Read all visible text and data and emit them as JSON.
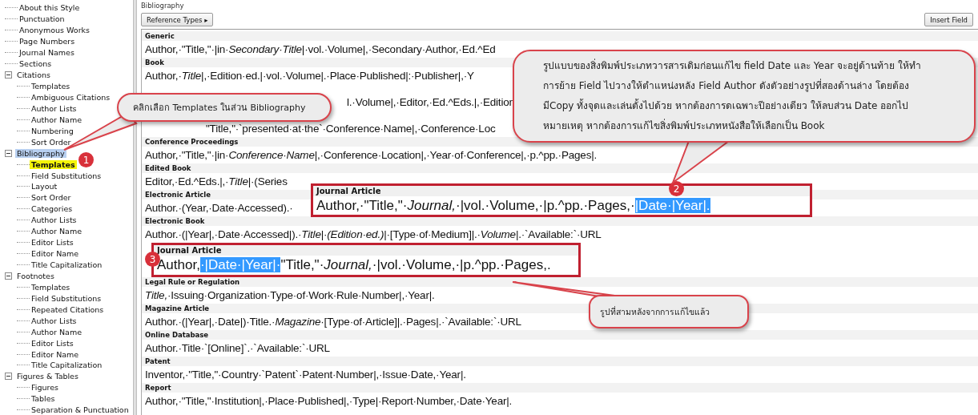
{
  "tree": [
    {
      "label": "About this Style",
      "selected": false,
      "highlighted": false
    },
    {
      "label": "Punctuation",
      "selected": false,
      "highlighted": false
    },
    {
      "label": "Anonymous Works",
      "selected": false,
      "highlighted": false
    },
    {
      "label": "Page Numbers",
      "selected": false,
      "highlighted": false
    },
    {
      "label": "Journal Names",
      "selected": false,
      "highlighted": false
    },
    {
      "label": "Sections",
      "selected": false,
      "highlighted": false
    },
    {
      "label": "Citations",
      "selected": false,
      "highlighted": false,
      "expanded": true,
      "children": [
        {
          "label": "Templates",
          "selected": false,
          "highlighted": false
        },
        {
          "label": "Ambiguous Citations",
          "selected": false,
          "highlighted": false
        },
        {
          "label": "Author Lists",
          "selected": false,
          "highlighted": false
        },
        {
          "label": "Author Name",
          "selected": false,
          "highlighted": false
        },
        {
          "label": "Numbering",
          "selected": false,
          "highlighted": false
        },
        {
          "label": "Sort Order",
          "selected": false,
          "highlighted": false
        }
      ]
    },
    {
      "label": "Bibliography",
      "selected": true,
      "highlighted": false,
      "expanded": true,
      "children": [
        {
          "label": "Templates",
          "selected": false,
          "highlighted": true
        },
        {
          "label": "Field Substitutions",
          "selected": false,
          "highlighted": false
        },
        {
          "label": "Layout",
          "selected": false,
          "highlighted": false
        },
        {
          "label": "Sort Order",
          "selected": false,
          "highlighted": false
        },
        {
          "label": "Categories",
          "selected": false,
          "highlighted": false
        },
        {
          "label": "Author Lists",
          "selected": false,
          "highlighted": false
        },
        {
          "label": "Author Name",
          "selected": false,
          "highlighted": false
        },
        {
          "label": "Editor Lists",
          "selected": false,
          "highlighted": false
        },
        {
          "label": "Editor Name",
          "selected": false,
          "highlighted": false
        },
        {
          "label": "Title Capitalization",
          "selected": false,
          "highlighted": false
        }
      ]
    },
    {
      "label": "Footnotes",
      "selected": false,
      "highlighted": false,
      "expanded": true,
      "children": [
        {
          "label": "Templates",
          "selected": false,
          "highlighted": false
        },
        {
          "label": "Field Substitutions",
          "selected": false,
          "highlighted": false
        },
        {
          "label": "Repeated Citations",
          "selected": false,
          "highlighted": false
        },
        {
          "label": "Author Lists",
          "selected": false,
          "highlighted": false
        },
        {
          "label": "Author Name",
          "selected": false,
          "highlighted": false
        },
        {
          "label": "Editor Lists",
          "selected": false,
          "highlighted": false
        },
        {
          "label": "Editor Name",
          "selected": false,
          "highlighted": false
        },
        {
          "label": "Title Capitalization",
          "selected": false,
          "highlighted": false
        }
      ]
    },
    {
      "label": "Figures & Tables",
      "selected": false,
      "highlighted": false,
      "expanded": true,
      "children": [
        {
          "label": "Figures",
          "selected": false,
          "highlighted": false
        },
        {
          "label": "Tables",
          "selected": false,
          "highlighted": false
        },
        {
          "label": "Separation & Punctuation",
          "selected": false,
          "highlighted": false
        }
      ]
    }
  ],
  "panel": {
    "title": "Bibliography",
    "reference_types_button": "Reference Types ▸",
    "insert_field_button": "Insert Field"
  },
  "templates": [
    {
      "kind": "row",
      "label": "Generic",
      "template": "Author,·\"Title,\"·|in·*Secondary·Title*|·vol.·Volume|,·Secondary·Author,·Ed.^Ed"
    },
    {
      "kind": "row",
      "label": "Book",
      "template": "Author,·*Title*|,·Edition·ed.|·vol.·Volume|.·Place·Published|:·Publisher|,·Y"
    },
    {
      "kind": "under_callout",
      "template": "l.·Volume|,·Editor,·Ed.^Eds.|,·Edition"
    },
    {
      "kind": "under_pointer",
      "template": "\"Title,\"·`presented·at·the`·Conference·Name|,·Conference·Loc"
    },
    {
      "kind": "row",
      "label": "Conference Proceedings",
      "template": "Author,·\"Title,\"·|in·*Conference·Name*|,·Conference·Location|,·Year·of·Conference|,·p.^pp.·Pages|."
    },
    {
      "kind": "row",
      "label": "Edited Book",
      "template": "Editor,·Ed.^Eds.|,·*Title*|·(Series"
    },
    {
      "kind": "row",
      "label": "Electronic Article",
      "template": "Author.·(Year,·Date·Accessed).·"
    },
    {
      "kind": "row",
      "label": "Electronic Book",
      "template": "Author.·(|Year|,·Date·Accessed|).·*Title*|·*(Edition·ed.)*|·[Type·of·Medium]|.·*Volume*|.·`Available:`·URL"
    },
    {
      "kind": "inset",
      "badge": "3",
      "label": "Journal Article",
      "template": "Author,",
      "selection": "·|Date·|Year|·",
      "rest": "\"Title,\"·*Journal,*·|vol.·Volume,·|p.^pp.·Pages,."
    },
    {
      "kind": "row",
      "label": "Legal Rule or Regulation",
      "template": "*Title,*·Issuing·Organization·Type·of·Work·Rule·Number|,·Year|."
    },
    {
      "kind": "row",
      "label": "Magazine Article",
      "template": "Author.·(|Year|,·Date|)·Title.·*Magazine*·[Type·of·Article]|.·Pages|.·`Available:`·URL"
    },
    {
      "kind": "row",
      "label": "Online Database",
      "template": "Author.·Title·`[Online]`.·`Available:`·URL"
    },
    {
      "kind": "row",
      "label": "Patent",
      "template": "Inventor,·\"Title,\"·Country·`Patent`·Patent·Number|,·Issue·Date,·Year|."
    },
    {
      "kind": "row",
      "label": "Report",
      "template": "Author,·\"Title,\"·Institution|,·Place·Published|,·Type|·Report·Number,·Date·Year|."
    }
  ],
  "original_box": {
    "badge": "2",
    "label": "Journal Article",
    "template": "Author,·\"Title,\"·*Journal,*·|vol.·Volume,·|p.^pp.·Pages,·",
    "selection": "|Date·|Year|."
  },
  "callouts": [
    {
      "kind": "left",
      "badge": "1",
      "text": "คลิกเลือก Templates ในส่วน Bibliography"
    },
    {
      "kind": "big",
      "lines": [
        "รูปแบบของสิ่งพิมพ์ประเภทวารสารเดิมก่อนแก้ไข field Date และ  Year จะอยู่ด้านท้าย ให้ทำ",
        "การย้าย Field ไปวางให้ตำแหน่งหลัง Field Author ดังตัวอย่างรูปที่สองด้านล่าง โดยต้อง",
        "มีCopy ทั้งจุดและเล่นตั้งไปด้วย หากต้องการดเฉพาะปีอย่างเดียว ให้ลบส่วน Date ออกไป",
        "หมายเหตุ หากต้องการแก้ไขสิ่งพิมพ์ประเภทหนังสือให้เลือกเป็น Book"
      ]
    },
    {
      "kind": "small",
      "text": "รูปที่สามหลังจากการแก้ไขแล้ว"
    }
  ]
}
